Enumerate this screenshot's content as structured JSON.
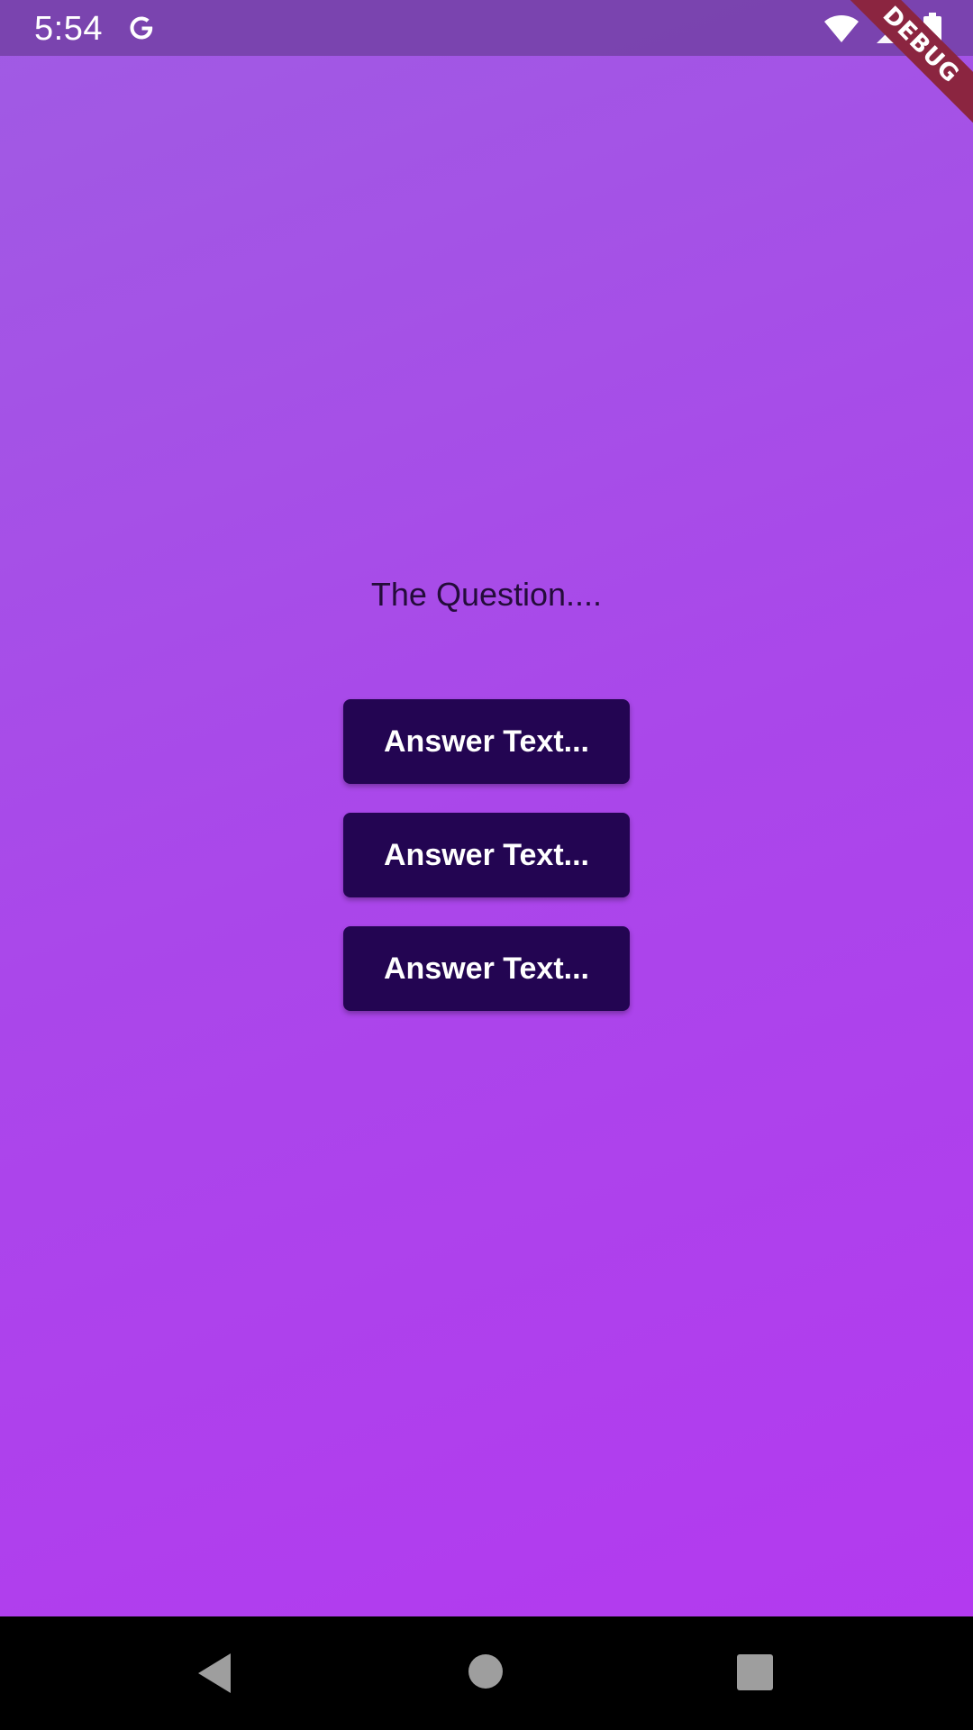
{
  "status_bar": {
    "time": "5:54",
    "icons": [
      "google-icon",
      "wifi-icon",
      "cellular-icon",
      "battery-icon"
    ]
  },
  "debug_banner": {
    "label": "DEBUG",
    "color": "#8b2540"
  },
  "quiz": {
    "question": "The Question....",
    "answers": [
      {
        "label": "Answer Text..."
      },
      {
        "label": "Answer Text..."
      },
      {
        "label": "Answer Text..."
      }
    ]
  },
  "colors": {
    "gradient_start": "#a05be3",
    "gradient_end": "#b33aef",
    "button": "#230552",
    "question_text": "#240c3a"
  },
  "nav_bar": {
    "icons": [
      "back-icon",
      "home-icon",
      "recents-icon"
    ]
  }
}
